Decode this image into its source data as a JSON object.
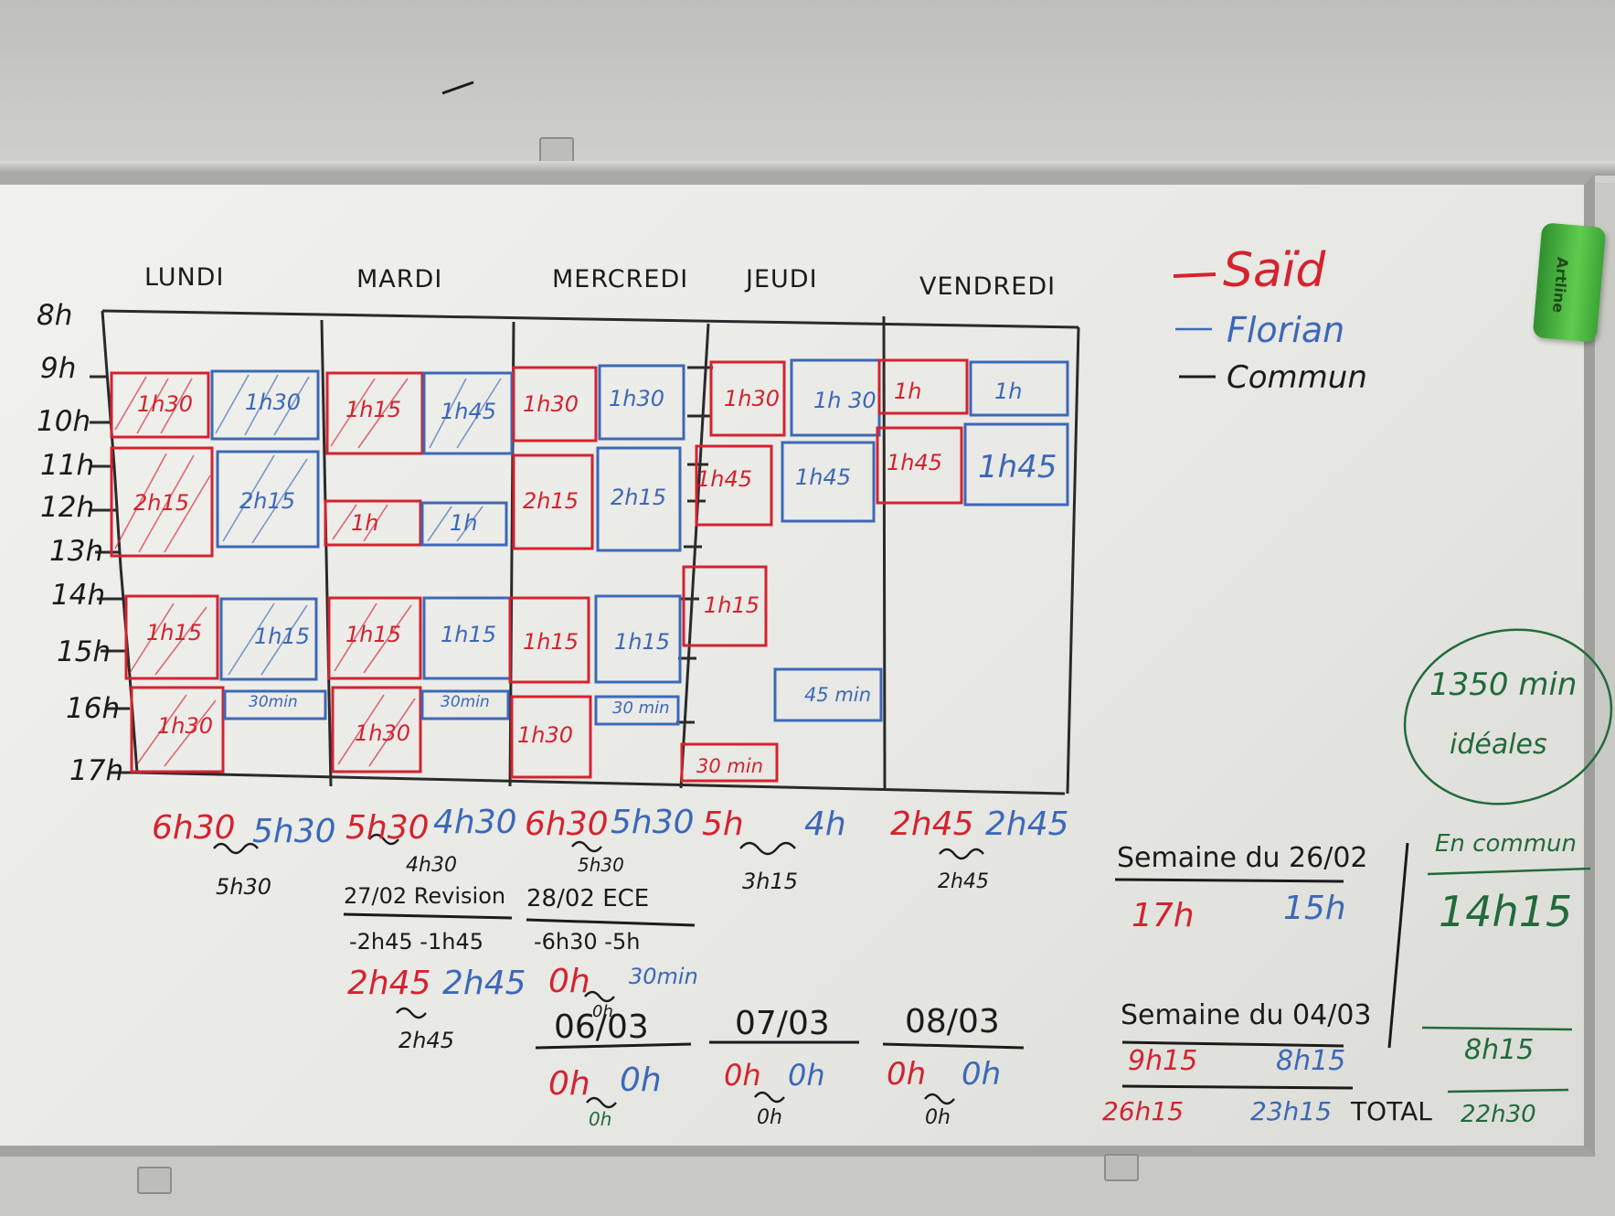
{
  "days": [
    "LUNDI",
    "MARDI",
    "MERCREDI",
    "JEUDI",
    "VENDREDI"
  ],
  "hours": [
    "8h",
    "9h",
    "10h",
    "11h",
    "12h",
    "13h",
    "14h",
    "15h",
    "16h",
    "17h"
  ],
  "legend": {
    "said": "Saïd",
    "florian": "Florian",
    "commun": "Commun",
    "colors": {
      "said": "#d4232f",
      "florian": "#3c68b8",
      "commun": "#1b1b1b"
    }
  },
  "blocks": {
    "lundi": {
      "r1": "1h30",
      "b1": "1h30",
      "r2": "2h15",
      "b2": "2h15",
      "r3": "1h15",
      "b3": "1h15",
      "r4": "1h30",
      "b4": "30min"
    },
    "mardi": {
      "r1": "1h15",
      "b1": "1h45",
      "r2": "1h",
      "b2": "1h",
      "r3": "1h15",
      "b3": "1h15",
      "r4": "1h30",
      "b4": "30min"
    },
    "mercredi": {
      "r1": "1h30",
      "b1": "1h30",
      "r2": "2h15",
      "b2": "2h15",
      "r3": "1h15",
      "b3": "1h15",
      "r4": "1h30",
      "b4": "30 min"
    },
    "jeudi": {
      "r1": "1h30",
      "b1": "1h 30",
      "r2": "1h45",
      "b2": "1h45",
      "r3": "1h15",
      "r4": "30 min",
      "b4": "45 min"
    },
    "vendredi": {
      "r1": "1h",
      "b1": "1h",
      "r2": "1h45",
      "b2": "1h45"
    }
  },
  "day_totals": {
    "lundi": {
      "said": "6h30",
      "florian": "5h30",
      "commun": "5h30"
    },
    "mardi": {
      "said": "5h30",
      "florian": "4h30",
      "commun": "4h30"
    },
    "mercredi": {
      "said": "6h30",
      "florian": "5h30",
      "commun": "5h30"
    },
    "jeudi": {
      "said": "5h",
      "florian": "4h",
      "commun": "3h15"
    },
    "vendredi": {
      "said": "2h45",
      "florian": "2h45",
      "commun": "2h45"
    }
  },
  "exceptions": {
    "e1": {
      "title": "27/02 Revision",
      "minus": "-2h45   -1h45",
      "said": "2h45",
      "florian": "2h45",
      "commun": "2h45"
    },
    "e2": {
      "title": "28/02 ECE",
      "minus": "-6h30  -5h",
      "said": "0h",
      "florian": "30min",
      "commun": "0h"
    }
  },
  "dates": [
    {
      "date": "06/03",
      "said": "0h",
      "florian": "0h",
      "commun": "0h"
    },
    {
      "date": "07/03",
      "said": "0h",
      "florian": "0h",
      "commun": "0h"
    },
    {
      "date": "08/03",
      "said": "0h",
      "florian": "0h",
      "commun": "0h"
    }
  ],
  "ideal": {
    "value": "1350 min",
    "label": "idéales"
  },
  "summary": {
    "week1": {
      "label": "Semaine du 26/02",
      "said": "17h",
      "florian": "15h"
    },
    "week2": {
      "label": "Semaine du 04/03",
      "said": "9h15",
      "florian": "8h15"
    },
    "totals": {
      "said": "26h15",
      "florian": "23h15",
      "label": "TOTAL",
      "commun": "22h30"
    },
    "commun": {
      "label": "En commun",
      "w1": "14h15",
      "w2": "8h15"
    }
  }
}
